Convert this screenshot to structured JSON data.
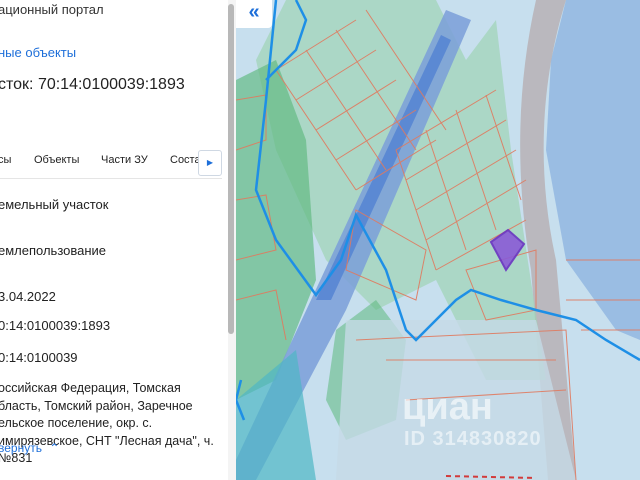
{
  "panel": {
    "portal_title": "ационный портал",
    "link_objects": "ные объекты",
    "parcel_title": "сток: 70:14:0100039:1893",
    "tabs": [
      {
        "label": "сы"
      },
      {
        "label": "Объекты"
      },
      {
        "label": "Части ЗУ"
      },
      {
        "label": "Соста"
      }
    ],
    "tab_scroll_icon": "triangle-right-icon",
    "fields": {
      "type": "емельный участок",
      "permitted_use": "емлепользование",
      "date": "3.04.2022",
      "cadastral_number": "0:14:0100039:1893",
      "quarter": "0:14:0100039",
      "address": "оссийская Федерация, Томская бласть, Томский район, Заречное ельское поселение, окр. с. имирязевское, СНТ \"Лесная дача\", ч. №831"
    },
    "collapse_label": "вернуть"
  },
  "map": {
    "back_button": "«",
    "watermark_brand": "циан",
    "watermark_id": "ID 314830820",
    "colors": {
      "water": "#c7dfee",
      "forest": "#5db87e",
      "road": "#7a9fd8",
      "parcel_border": "#e07a5f",
      "boundary_line": "#1e8fe6",
      "selected_parcel": "#7c4dcc"
    }
  }
}
